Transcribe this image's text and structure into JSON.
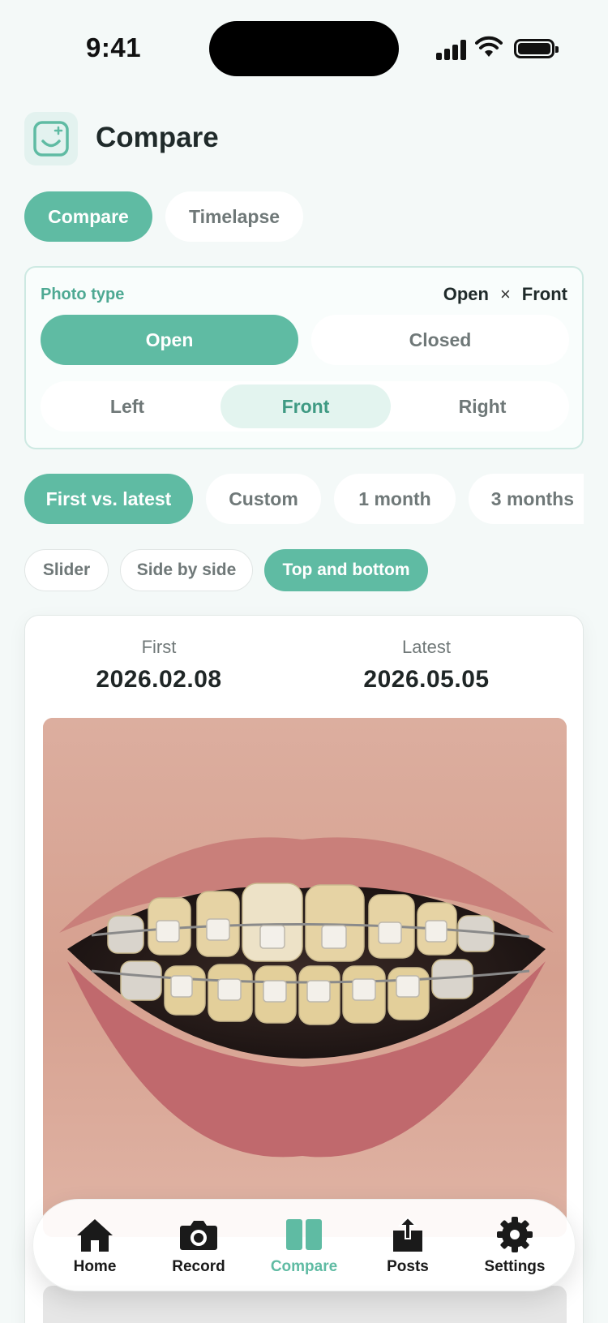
{
  "status_bar": {
    "time": "9:41"
  },
  "header": {
    "title": "Compare"
  },
  "mode_tabs": [
    {
      "label": "Compare",
      "active": true
    },
    {
      "label": "Timelapse",
      "active": false
    }
  ],
  "photo_type": {
    "label": "Photo type",
    "summary_mouth": "Open",
    "summary_sep": "×",
    "summary_angle": "Front",
    "mouth_options": [
      {
        "label": "Open",
        "active": true
      },
      {
        "label": "Closed",
        "active": false
      }
    ],
    "angle_options": [
      {
        "label": "Left",
        "active": false
      },
      {
        "label": "Front",
        "active": true
      },
      {
        "label": "Right",
        "active": false
      }
    ]
  },
  "range_chips": [
    {
      "label": "First vs. latest",
      "active": true
    },
    {
      "label": "Custom",
      "active": false
    },
    {
      "label": "1 month",
      "active": false
    },
    {
      "label": "3 months",
      "active": false
    }
  ],
  "view_chips": [
    {
      "label": "Slider",
      "active": false
    },
    {
      "label": "Side by side",
      "active": false
    },
    {
      "label": "Top and bottom",
      "active": true
    }
  ],
  "comparison": {
    "first_label": "First",
    "first_date": "2026.02.08",
    "latest_label": "Latest",
    "latest_date": "2026.05.05"
  },
  "bottom_nav": [
    {
      "label": "Home",
      "icon": "home-icon",
      "active": false
    },
    {
      "label": "Record",
      "icon": "camera-icon",
      "active": false
    },
    {
      "label": "Compare",
      "icon": "compare-icon",
      "active": true
    },
    {
      "label": "Posts",
      "icon": "share-icon",
      "active": false
    },
    {
      "label": "Settings",
      "icon": "gear-icon",
      "active": false
    }
  ],
  "colors": {
    "accent": "#5fbba3",
    "accent_soft": "#e3f4ef",
    "background": "#f4f9f8"
  }
}
